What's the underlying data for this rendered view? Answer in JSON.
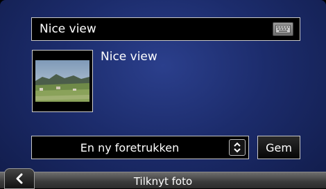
{
  "poi": {
    "name_value": "Nice view",
    "caption": "Nice view"
  },
  "icons": {
    "keyboard": "keyboard-icon",
    "spinner": "up-down-arrows-icon",
    "back": "chevron-left-icon",
    "photo": "landscape-photo"
  },
  "category": {
    "selected": "En ny foretrukken"
  },
  "actions": {
    "save_label": "Gem"
  },
  "footer": {
    "title": "Tilknyt foto"
  }
}
